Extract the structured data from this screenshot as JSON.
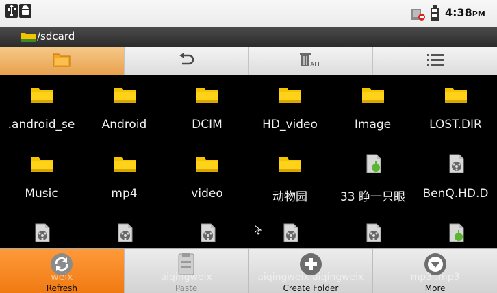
{
  "status_bar": {
    "time": "4:38",
    "ampm": "PM",
    "icons": [
      "usb-icon",
      "android-debug-icon",
      "no-sim-icon",
      "battery-icon"
    ]
  },
  "path_bar": {
    "path": "/sdcard",
    "icon": "folder-icon"
  },
  "toolbar": {
    "items": [
      {
        "icon": "folder-up-icon"
      },
      {
        "icon": "back-arrow-icon"
      },
      {
        "icon": "trash-all-icon",
        "text": "ALL"
      },
      {
        "icon": "list-view-icon"
      }
    ]
  },
  "files": [
    {
      "name": ".android_se",
      "type": "folder"
    },
    {
      "name": "Android",
      "type": "folder"
    },
    {
      "name": "DCIM",
      "type": "folder"
    },
    {
      "name": "HD_video",
      "type": "folder"
    },
    {
      "name": "Image",
      "type": "folder"
    },
    {
      "name": "LOST.DIR",
      "type": "folder"
    },
    {
      "name": "Music",
      "type": "folder"
    },
    {
      "name": "mp4",
      "type": "folder"
    },
    {
      "name": "video",
      "type": "folder"
    },
    {
      "name": "动物园",
      "type": "folder"
    },
    {
      "name": "33 睁一只眼",
      "type": "audio"
    },
    {
      "name": "BenQ.HD.D",
      "type": "video"
    },
    {
      "name": "",
      "type": "video"
    },
    {
      "name": "",
      "type": "video"
    },
    {
      "name": "",
      "type": "video"
    },
    {
      "name": "",
      "type": "video"
    },
    {
      "name": "",
      "type": "video"
    },
    {
      "name": "",
      "type": "audio"
    }
  ],
  "menu": {
    "items": [
      {
        "label": "Refresh",
        "icon": "refresh-icon",
        "ghost": "weix"
      },
      {
        "label": "Paste",
        "icon": "clipboard-icon",
        "ghost": "aiqingweix"
      },
      {
        "label": "Create Folder",
        "icon": "plus-circle-icon",
        "ghost": "aiqingweix aiqingweix"
      },
      {
        "label": "More",
        "icon": "chevron-down-circle-icon",
        "ghost": "mp3 .mp3"
      }
    ]
  },
  "colors": {
    "folder": "#f5c400",
    "accent": "#f07a12",
    "background": "#000000"
  }
}
